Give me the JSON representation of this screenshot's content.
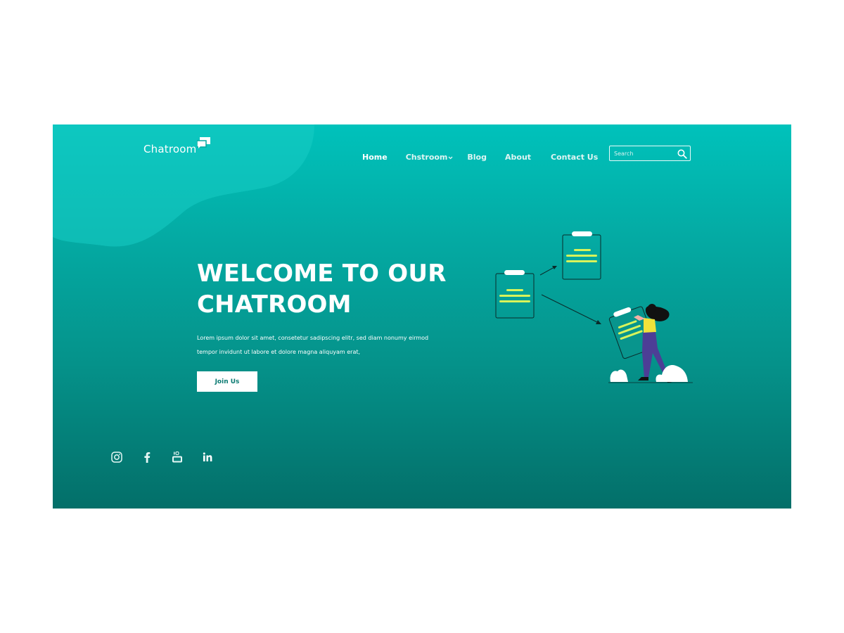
{
  "brand": {
    "name": "Chatroom",
    "icon": "chat-bubbles-icon"
  },
  "nav": {
    "items": [
      {
        "label": "Home",
        "active": true
      },
      {
        "label": "Chstroom",
        "has_dropdown": true
      },
      {
        "label": "Blog"
      },
      {
        "label": "About"
      },
      {
        "label": "Contact Us"
      }
    ]
  },
  "search": {
    "placeholder": "Search",
    "value": "",
    "icon": "search-icon"
  },
  "hero": {
    "headline_line1": "WELCOME TO OUR",
    "headline_line2": "CHATROOM",
    "lead_line1": "Lorem ipsum dolor sit amet, consetetur sadipscing elitr, sed diam nonumy eirmod",
    "lead_line2": "tempor invidunt ut labore et dolore magna aliquyam erat,",
    "cta_label": "Join Us"
  },
  "social": {
    "icons": [
      "instagram-icon",
      "facebook-icon",
      "youtube-icon",
      "linkedin-icon"
    ]
  },
  "colors": {
    "gradient_top": "#00c2bb",
    "gradient_bottom": "#036f69",
    "cta_text": "#0a7a72",
    "clipboard_lines": "#d8f35a",
    "figure_pants": "#4d3e96",
    "figure_shirt": "#f0e23a"
  }
}
